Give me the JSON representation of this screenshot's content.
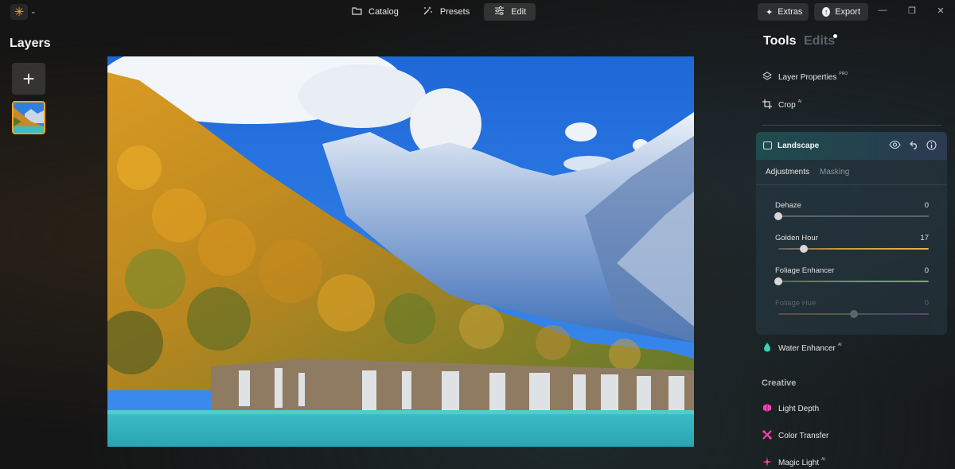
{
  "topbar": {
    "modes": [
      {
        "label": "Catalog",
        "icon": "folder-icon",
        "active": false
      },
      {
        "label": "Presets",
        "icon": "sparkle-wand-icon",
        "active": false
      },
      {
        "label": "Edit",
        "icon": "sliders-icon",
        "active": true
      }
    ],
    "extras_label": "Extras",
    "export_label": "Export"
  },
  "layers": {
    "title": "Layers"
  },
  "panel": {
    "tabs": [
      {
        "label": "Tools",
        "active": true
      },
      {
        "label": "Edits",
        "active": false
      }
    ],
    "tools": [
      {
        "label": "Layer Properties",
        "badge": "PRO",
        "icon": "layers-icon"
      },
      {
        "label": "Crop",
        "badge": "AI",
        "icon": "crop-icon"
      }
    ],
    "landscape": {
      "title": "Landscape",
      "subtabs": [
        "Adjustments",
        "Masking"
      ],
      "sliders": [
        {
          "label": "Dehaze",
          "value": "0",
          "position": 0.0,
          "disabled": false
        },
        {
          "label": "Golden Hour",
          "value": "17",
          "position": 0.17,
          "disabled": false
        },
        {
          "label": "Foliage Enhancer",
          "value": "0",
          "position": 0.0,
          "disabled": false
        },
        {
          "label": "Foliage Hue",
          "value": "0",
          "position": 0.5,
          "disabled": true
        }
      ]
    },
    "water_enhancer": {
      "label": "Water Enhancer",
      "badge": "AI"
    },
    "creative_section": "Creative",
    "creative_tools": [
      {
        "label": "Light Depth",
        "badge": ""
      },
      {
        "label": "Color Transfer",
        "badge": ""
      },
      {
        "label": "Magic Light",
        "badge": "AI"
      }
    ]
  },
  "colors": {
    "accent_orange": "#e9a623",
    "golden_hour_track": "#e3b24a",
    "foliage_track": "#7fae4a",
    "water_icon": "#37d3b8",
    "creative_icon": "#ff3fb5"
  }
}
